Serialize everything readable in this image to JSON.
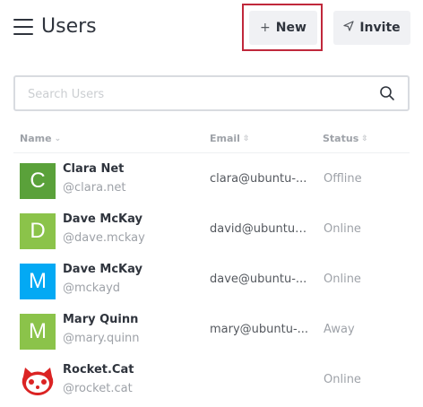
{
  "header": {
    "title": "Users",
    "new_button": {
      "label": "New",
      "icon": "plus-icon"
    },
    "invite_button": {
      "label": "Invite",
      "icon": "send-icon"
    },
    "highlight_color": "#c0283b"
  },
  "search": {
    "placeholder": "Search Users",
    "value": ""
  },
  "table": {
    "columns": [
      {
        "label": "Name",
        "sortable": true
      },
      {
        "label": "Email",
        "sortable": true
      },
      {
        "label": "Status",
        "sortable": true
      }
    ],
    "rows": [
      {
        "name": "Clara Net",
        "username": "@clara.net",
        "email": "clara@ubuntu-...",
        "status": "Offline",
        "avatar_letter": "C",
        "avatar_color": "#5aa13a"
      },
      {
        "name": "Dave McKay",
        "username": "@dave.mckay",
        "email": "david@ubuntu-...",
        "status": "Online",
        "avatar_letter": "D",
        "avatar_color": "#8bc34a"
      },
      {
        "name": "Dave McKay",
        "username": "@mckayd",
        "email": "dave@ubuntu-...",
        "status": "Online",
        "avatar_letter": "M",
        "avatar_color": "#03a9f4"
      },
      {
        "name": "Mary Quinn",
        "username": "@mary.quinn",
        "email": "mary@ubuntu-...",
        "status": "Away",
        "avatar_letter": "M",
        "avatar_color": "#8bc34a"
      },
      {
        "name": "Rocket.Cat",
        "username": "@rocket.cat",
        "email": "",
        "status": "Online",
        "avatar_icon": "rocket-cat-icon",
        "avatar_color": "#db2323"
      }
    ]
  }
}
